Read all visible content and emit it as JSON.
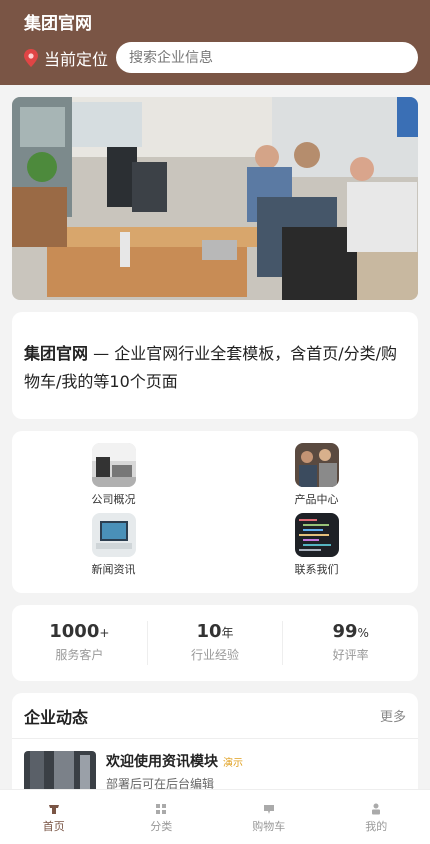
{
  "header": {
    "title": "集团官网",
    "location_icon": "location-pin-icon",
    "location_label": "当前定位",
    "search_placeholder": "搜索企业信息"
  },
  "banner": {
    "image": "office-team-meeting-photo"
  },
  "intro": {
    "brand": "集团官网",
    "text": " — 企业官网行业全套模板，含首页/分类/购物车/我的等10个页面"
  },
  "shortcuts": [
    {
      "label": "公司概况",
      "icon": "company-overview-thumbnail"
    },
    {
      "label": "产品中心",
      "icon": "product-center-thumbnail"
    },
    {
      "label": "新闻资讯",
      "icon": "news-thumbnail"
    },
    {
      "label": "联系我们",
      "icon": "contact-thumbnail"
    }
  ],
  "stats": [
    {
      "value": "1000",
      "unit": "+",
      "label": "服务客户"
    },
    {
      "value": "10",
      "unit": "年",
      "label": "行业经验"
    },
    {
      "value": "99",
      "unit": "%",
      "label": "好评率"
    }
  ],
  "news": {
    "title": "企业动态",
    "more": "更多",
    "items": [
      {
        "title": "欢迎使用资讯模块",
        "badge": "演示",
        "desc": "部署后可在后台编辑"
      }
    ]
  },
  "tabbar": [
    {
      "label": "首页",
      "icon": "home-icon",
      "active": true
    },
    {
      "label": "分类",
      "icon": "category-icon",
      "active": false
    },
    {
      "label": "购物车",
      "icon": "cart-icon",
      "active": false
    },
    {
      "label": "我的",
      "icon": "user-icon",
      "active": false
    }
  ],
  "colors": {
    "brand": "#7a5545",
    "badge": "#e0a020"
  }
}
